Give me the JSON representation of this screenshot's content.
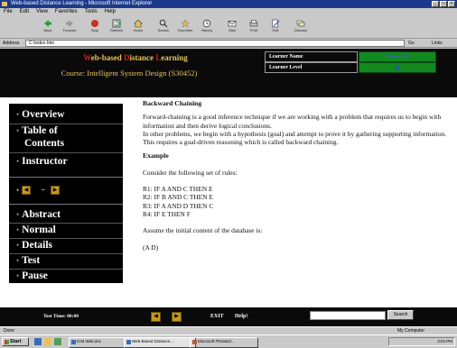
{
  "browser": {
    "title": "Web-based Distance Learning - Microsoft Internet Explorer",
    "menu": [
      "File",
      "Edit",
      "View",
      "Favorites",
      "Tools",
      "Help"
    ],
    "toolbar": [
      "Back",
      "Forward",
      "Stop",
      "Refresh",
      "Home",
      "Search",
      "Favorites",
      "History",
      "Mail",
      "Print",
      "Edit",
      "Discuss"
    ],
    "address_label": "Address",
    "address_value": "C:\\index.htm",
    "go_label": "Go",
    "links_label": "Links",
    "status_text": "Done",
    "status_zone": "My Computer"
  },
  "header": {
    "site_title_first": "W",
    "site_title_rest1": "eb-based ",
    "site_title_d": "D",
    "site_title_rest2": "istance ",
    "site_title_l": "L",
    "site_title_rest3": "earning",
    "course": "Course: Intelligent System Design (S30452)",
    "learner_name_label": "Learner Name",
    "learner_name_value": "Ahmed Ali",
    "learner_level_label": "Learner Level",
    "learner_level_value": "A"
  },
  "nav": {
    "top": [
      "Overview",
      "Table of",
      "Contents",
      "Instructor"
    ],
    "bottom": [
      "Abstract",
      "Normal",
      "Details",
      "Test",
      "Pause"
    ]
  },
  "content": {
    "heading": "Backward Chaining",
    "para1": "Forward-chaining is a good inference technique if we are working with a problem that requires us to begin with information and then derive logical conclusions.",
    "para2": "In other problems, we begin with a hypothesis (goal) and attempt to prove it by gathering supporting information. This requires a goal-driven reasoning which is called backward chaining.",
    "example_heading": "Example",
    "example_intro": "Consider the following set of rules:",
    "rules": [
      "R1: IF A AND C THEN E",
      "R2: IF B AND C THEN E",
      "R3: IF A AND D THEN C",
      "R4: IF E THEN F"
    ],
    "assume": "Assume the initial content of the database is:",
    "database": "(A D)"
  },
  "footer": {
    "test_time": "Test Time: 00:00",
    "exit": "EXIT",
    "help": "Help!",
    "search_button": "Search"
  },
  "taskbar": {
    "start": "Start",
    "tasks": [
      "ICM Web.doc",
      "Web-Based Distance...",
      "Microsoft PhotoEd..."
    ],
    "clock": "3:04 PM"
  }
}
